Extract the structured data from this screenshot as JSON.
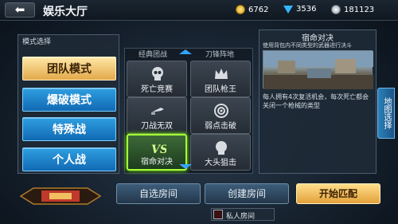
{
  "header": {
    "back_icon": "back-arrow-icon",
    "title": "娱乐大厅",
    "gold": "6762",
    "diamonds": "3536",
    "silver": "181123"
  },
  "mode_panel": {
    "label": "模式选择",
    "modes": [
      {
        "label": "团队模式",
        "active": true
      },
      {
        "label": "爆破模式",
        "active": false
      },
      {
        "label": "特殊战",
        "active": false
      },
      {
        "label": "个人战",
        "active": false
      }
    ]
  },
  "grid": {
    "header_left": "经典团战",
    "header_right": "刀锋阵地",
    "tiles": [
      {
        "label": "死亡竞赛",
        "icon": "skull-icon",
        "selected": false
      },
      {
        "label": "团队枪王",
        "icon": "crown-icon",
        "selected": false
      },
      {
        "label": "刀战无双",
        "icon": "knife-icon",
        "selected": false
      },
      {
        "label": "弱点击破",
        "icon": "target-icon",
        "selected": false
      },
      {
        "label": "宿命对决",
        "icon": "vs-icon",
        "selected": true
      },
      {
        "label": "大头狙击",
        "icon": "head-icon",
        "selected": false
      }
    ]
  },
  "preview": {
    "title": "宿命对决",
    "subtitle": "使用背包内不同类型的武器进行决斗",
    "description": "每人拥有4次复活机会，每次死亡都会关闭一个枪械的类型"
  },
  "side_tab": "地图选择",
  "actions": {
    "custom_room": "自选房间",
    "create_room": "创建房间",
    "start_match": "开始匹配",
    "private_room": "私人房间"
  },
  "colors": {
    "accent_blue": "#1169b4",
    "accent_gold": "#e3a84a",
    "selected_green": "#a6ff3a"
  }
}
